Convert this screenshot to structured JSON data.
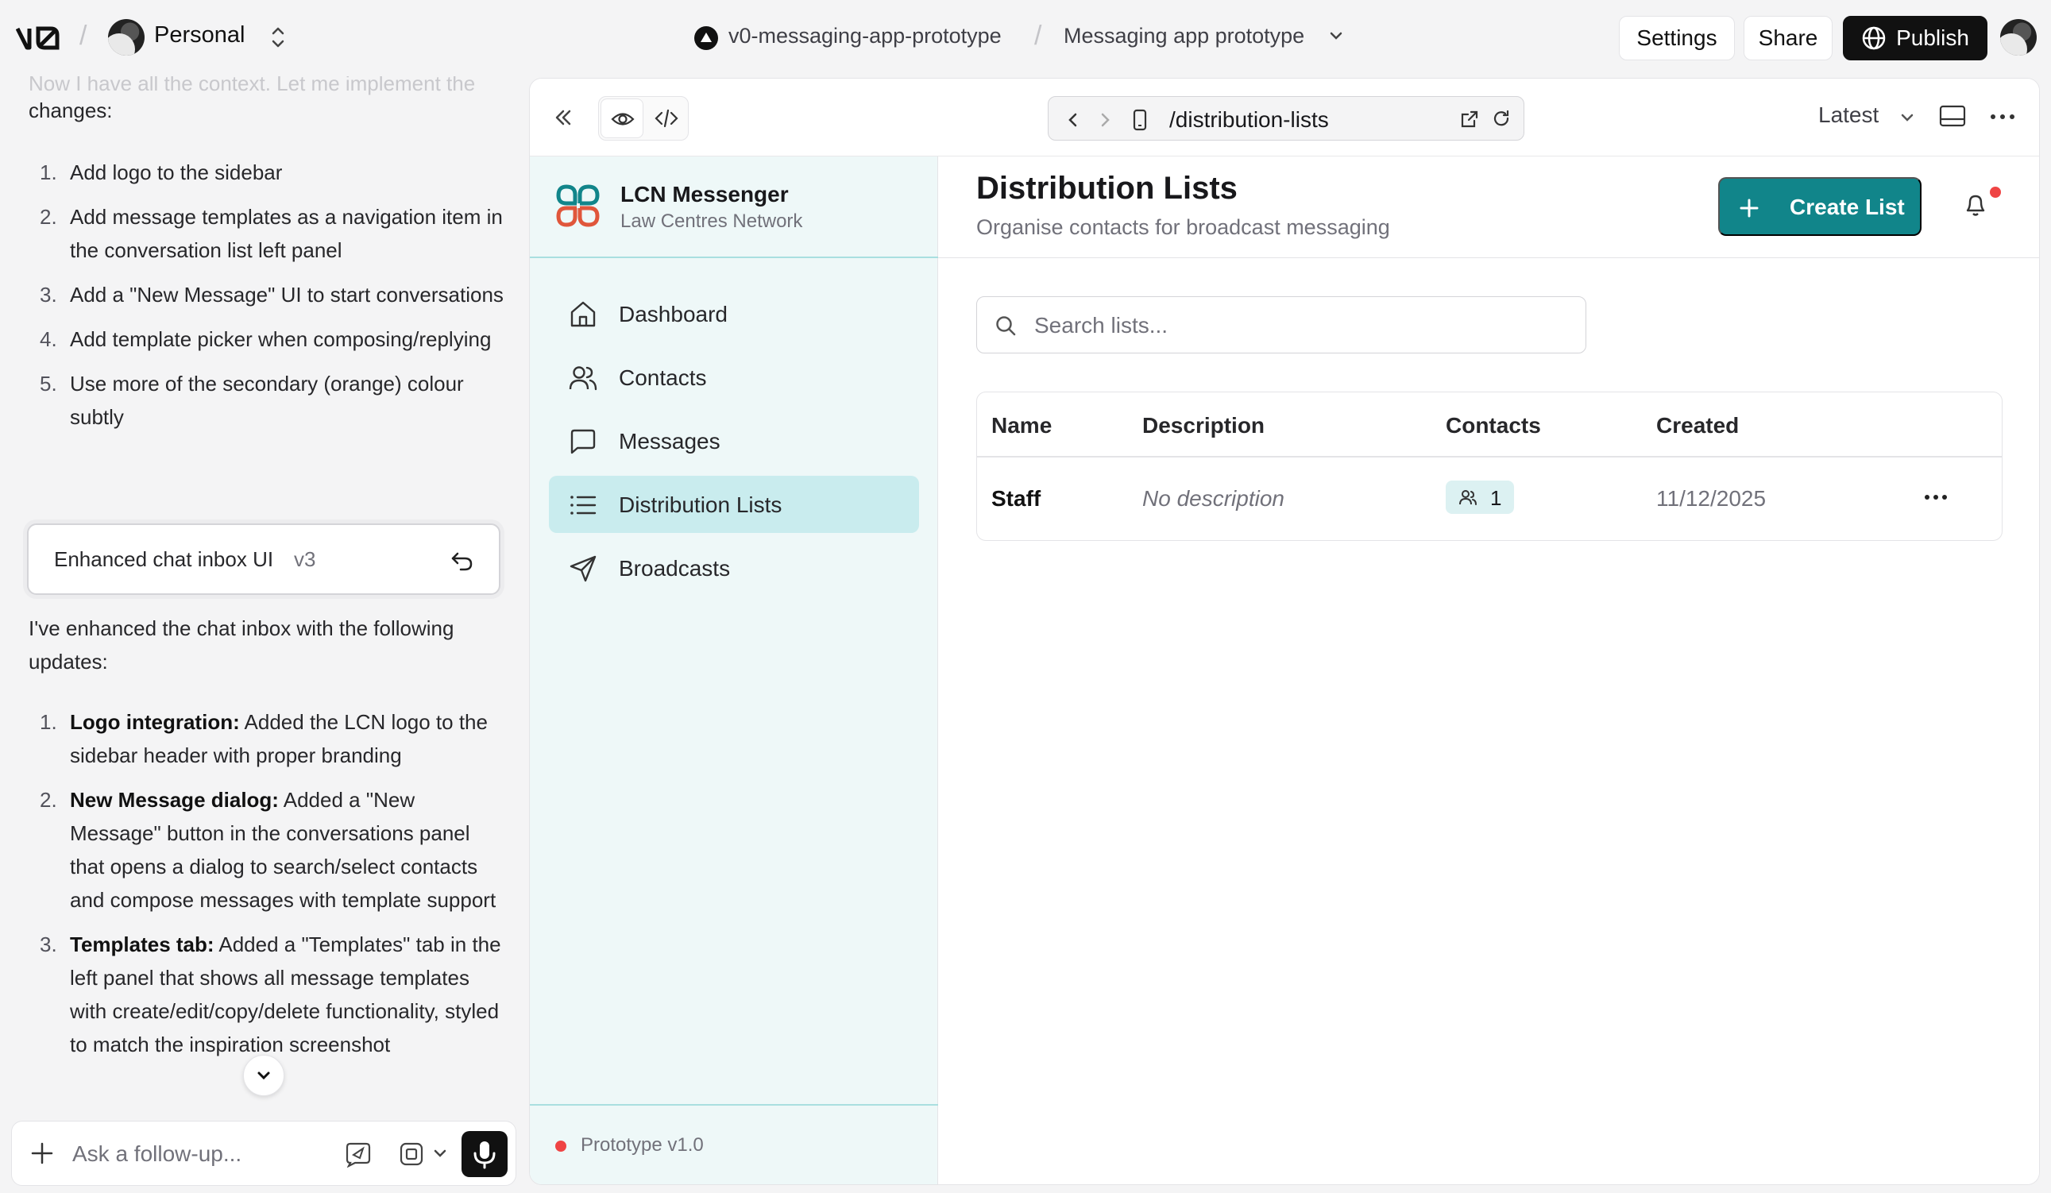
{
  "topbar": {
    "team": "Personal",
    "project": "v0-messaging-app-prototype",
    "chat_title": "Messaging app prototype",
    "settings": "Settings",
    "share": "Share",
    "publish": "Publish"
  },
  "chat": {
    "fade_line": "Now I have all the context. Let me implement the",
    "intro": "changes:",
    "plan": [
      {
        "n": "1.",
        "text": "Add logo to the sidebar"
      },
      {
        "n": "2.",
        "text": "Add message templates as a navigation item in the conversation list left panel"
      },
      {
        "n": "3.",
        "text": "Add a \"New Message\" UI to start conversations"
      },
      {
        "n": "4.",
        "text": "Add template picker when composing/replying"
      },
      {
        "n": "5.",
        "text": "Use more of the secondary (orange) colour subtly"
      }
    ],
    "version_card": {
      "title": "Enhanced chat inbox UI",
      "version": "v3"
    },
    "summary_intro": "I've enhanced the chat inbox with the following updates:",
    "updates": [
      {
        "n": "1.",
        "bold": "Logo integration:",
        "text": " Added the LCN logo to the sidebar header with proper branding"
      },
      {
        "n": "2.",
        "bold": "New Message dialog:",
        "text": " Added a \"New Message\" button in the conversations panel that opens a dialog to search/select contacts and compose messages with template support"
      },
      {
        "n": "3.",
        "bold": "Templates tab:",
        "text": " Added a \"Templates\" tab in the left panel that shows all message templates with create/edit/copy/delete functionality, styled to match the inspiration screenshot"
      }
    ],
    "composer_placeholder": "Ask a follow-up..."
  },
  "preview": {
    "url_path": "/distribution-lists",
    "version_select": "Latest"
  },
  "app": {
    "name": "LCN Messenger",
    "subtitle": "Law Centres Network",
    "nav": [
      {
        "label": "Dashboard",
        "icon": "home-icon",
        "active": false
      },
      {
        "label": "Contacts",
        "icon": "users-icon",
        "active": false
      },
      {
        "label": "Messages",
        "icon": "message-square-icon",
        "active": false
      },
      {
        "label": "Distribution Lists",
        "icon": "list-icon",
        "active": true
      },
      {
        "label": "Broadcasts",
        "icon": "send-icon",
        "active": false
      }
    ],
    "footer": "Prototype v1.0",
    "page_title": "Distribution Lists",
    "page_subtitle": "Organise contacts for broadcast messaging",
    "create_button": "Create List",
    "search_placeholder": "Search lists...",
    "table": {
      "headers": [
        "Name",
        "Description",
        "Contacts",
        "Created"
      ],
      "rows": [
        {
          "name": "Staff",
          "description": "No description",
          "contacts": "1",
          "created": "11/12/2025"
        }
      ]
    },
    "colors": {
      "primary": "#11858a",
      "sidebar_bg": "#eef8f8",
      "active_bg": "#c9ecee",
      "notification": "#ef4444"
    }
  }
}
